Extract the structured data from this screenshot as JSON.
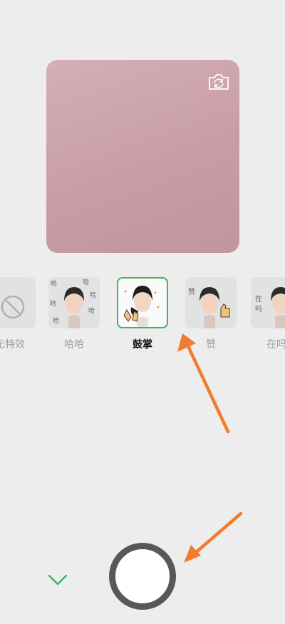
{
  "effects": [
    {
      "label": "无特效",
      "icon": "none-icon"
    },
    {
      "label": "哈哈",
      "icon": "haha-sticker"
    },
    {
      "label": "鼓掌",
      "icon": "clap-sticker",
      "selected": true
    },
    {
      "label": "赞",
      "icon": "thumbs-up-sticker"
    },
    {
      "label": "在吗",
      "icon": "are-you-there-sticker"
    }
  ],
  "colors": {
    "background": "#ededed",
    "preview": "#cfa7ae",
    "selected_border": "#3bb55e",
    "annotation_arrow": "#f07c2c",
    "shutter_ring": "#585858"
  },
  "icons": {
    "switch_camera": "camera-switch-icon",
    "collapse": "chevron-down-icon",
    "shutter": "shutter-button"
  }
}
